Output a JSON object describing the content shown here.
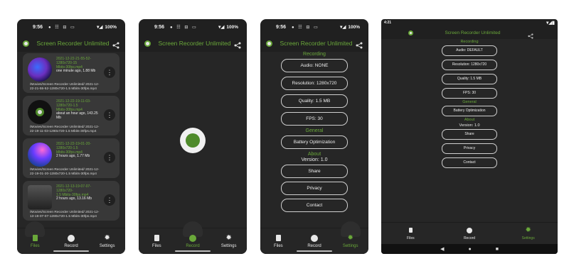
{
  "status": {
    "time1": "9:56",
    "time4": "4:21",
    "battery": "100%",
    "icons": "● ☷ ⊟ ▭"
  },
  "app": {
    "title": "Screen Recorder Unlimited"
  },
  "nav": {
    "files": "Files",
    "record": "Record",
    "settings": "Settings"
  },
  "files": [
    {
      "name": "2021-12-22-21-55-52-1280x720-15",
      "fps": "Mbits-30fps.mp4",
      "meta": "one minute ago, 1.88 Mb",
      "path": "/Movies/Screen Recorder Unlimited/ 2021-12-22-21-55-52-1280x720-1.5 Mbits-30fps.mp4"
    },
    {
      "name": "2021-12-22-19-11-03-1280x720-1.5",
      "fps": "Mbits-30fps.mp4",
      "meta": "about an hour ago, 143.25 Mb",
      "path": "/Movies/Screen Recorder Unlimited/ 2021-12-22-19-11-03-1280x720-1.5 Mbits-30fps.mp4"
    },
    {
      "name": "2021-12-22-19-01-20-1280x720-1.5",
      "fps": "Mbits-30fps.mp4",
      "meta": "2 hours ago, 1.77 Mb",
      "path": "/Movies/Screen Recorder Unlimited/ 2021-12-22-19-01-20-1280x720-1.5 Mbits-30fps.mp4"
    },
    {
      "name": "2021-12-13-19-07-07-1280x720-",
      "fps": "1.5 Mbits-30fps.mp4",
      "meta": "2 hours ago, 13.16 Mb",
      "path": "/Movies/Screen Recorder Unlimited/ 2021-12-13-19-07-07-1280x720-1.5 Mbits-30fps.mp4"
    }
  ],
  "settings": {
    "recording_header": "Recording",
    "audio_none": "Audio: NONE",
    "audio_default": "Audio: DEFAULT",
    "resolution": "Resolution: 1280x720",
    "quality": "Quality: 1.5 MB",
    "fps": "FPS: 30",
    "general_header": "General",
    "battery": "Battery Optimization",
    "about_header": "About",
    "version": "Version: 1.0",
    "share": "Share",
    "privacy": "Privacy",
    "contact": "Contact"
  },
  "colors": {
    "accent": "#6aa83a",
    "bg": "#202020",
    "card": "#383838"
  }
}
